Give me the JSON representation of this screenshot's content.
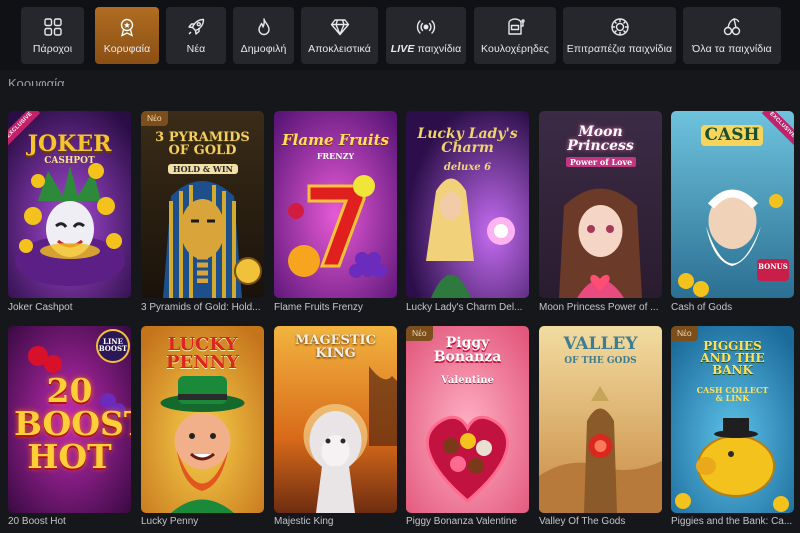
{
  "categories": [
    {
      "label": "Πάροχοι",
      "icon": "grid-icon",
      "active": false
    },
    {
      "label": "Κορυφαία",
      "icon": "award-icon",
      "active": true
    },
    {
      "label": "Νέα",
      "icon": "rocket-icon",
      "active": false
    },
    {
      "label": "Δημοφιλή",
      "icon": "flame-icon",
      "active": false
    },
    {
      "label": "Αποκλειστικά",
      "icon": "diamond-icon",
      "active": false
    },
    {
      "label_bold": "LIVE",
      "label": "παιχνίδια",
      "icon": "broadcast-icon",
      "active": false
    },
    {
      "label": "Κουλοχέρηδες",
      "icon": "slot-machine-icon",
      "active": false
    },
    {
      "label": "Επιτραπέζια παιχνίδια",
      "icon": "chip-icon",
      "active": false
    },
    {
      "label": "Όλα τα παιχνίδια",
      "icon": "cherries-icon",
      "active": false
    }
  ],
  "section_title": "Κορυφαία",
  "badges": {
    "new": "Νέο",
    "exclusive": "EXCLUSIVE"
  },
  "games": [
    {
      "name": "Joker Cashpot",
      "art_title": "JOKER",
      "art_sub": "CASHPOT",
      "exclusive": true,
      "new": false
    },
    {
      "name": "3 Pyramids of Gold: Hold...",
      "art_title": "3 PYRAMIDS OF GOLD",
      "art_sub": "HOLD & WIN",
      "exclusive": false,
      "new": true
    },
    {
      "name": "Flame Fruits Frenzy",
      "art_title": "Flame Fruits",
      "art_sub": "FRENZY",
      "exclusive": false,
      "new": false
    },
    {
      "name": "Lucky Lady's Charm Del...",
      "art_title": "Lucky Lady's Charm",
      "art_sub": "deluxe 6",
      "exclusive": false,
      "new": false
    },
    {
      "name": "Moon Princess Power of ...",
      "art_title": "Moon Princess",
      "art_sub": "Power of Love",
      "exclusive": false,
      "new": false
    },
    {
      "name": "Cash of Gods",
      "art_title": "CASH",
      "art_sub": "BONUS",
      "exclusive": true,
      "new": false
    },
    {
      "name": "20 Boost Hot",
      "art_title": "20 BOOST HOT",
      "art_sub": "LINE BOOST",
      "exclusive": false,
      "new": false
    },
    {
      "name": "Lucky Penny",
      "art_title": "LUCKY PENNY",
      "art_sub": "",
      "exclusive": false,
      "new": false
    },
    {
      "name": "Majestic King",
      "art_title": "MAGESTIC KING",
      "art_sub": "",
      "exclusive": false,
      "new": false
    },
    {
      "name": "Piggy Bonanza Valentine",
      "art_title": "Piggy Bonanza",
      "art_sub": "Valentine",
      "exclusive": false,
      "new": true
    },
    {
      "name": "Valley Of The Gods",
      "art_title": "VALLEY",
      "art_sub": "OF THE GODS",
      "exclusive": false,
      "new": false
    },
    {
      "name": "Piggies and the Bank: Ca...",
      "art_title": "PIGGIES AND THE BANK",
      "art_sub": "CASH COLLECT & LINK",
      "exclusive": false,
      "new": true
    }
  ],
  "colors": {
    "accent": "#a9621d",
    "background": "#16171b",
    "tile_bg": "#25272c"
  }
}
